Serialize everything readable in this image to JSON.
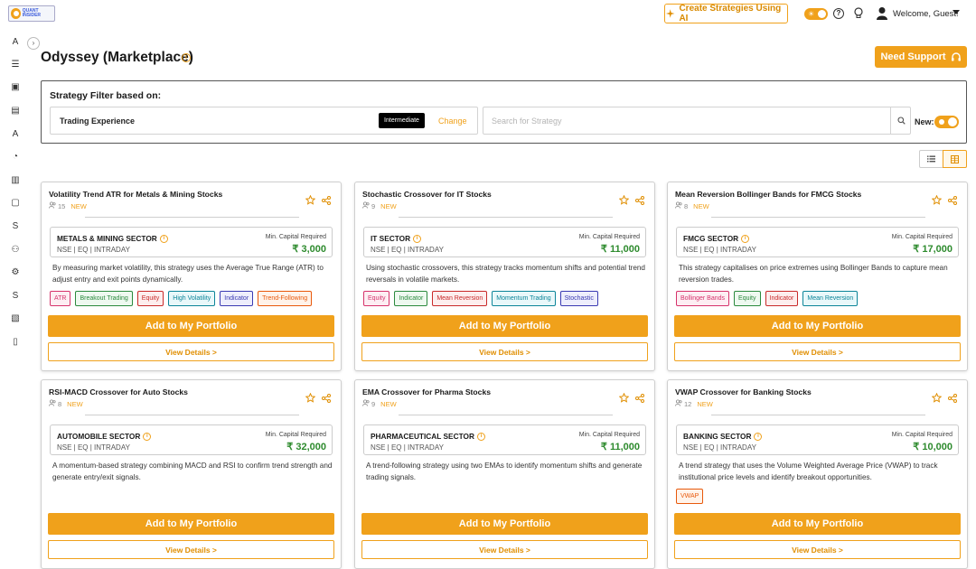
{
  "header": {
    "logo_text": "QUANT INSIDER",
    "create_ai_label": "Create Strategies Using AI",
    "welcome_text": "Welcome, Guest!",
    "help_glyph": "?",
    "bulb_glyph": "💡"
  },
  "sidebar": {
    "collapse_glyph": "›",
    "items": [
      {
        "glyph": "A",
        "icon": "text-a-icon"
      },
      {
        "glyph": "☰",
        "icon": "list-icon"
      },
      {
        "glyph": "▣",
        "icon": "terminal-icon"
      },
      {
        "glyph": "▤",
        "icon": "image-icon"
      },
      {
        "glyph": "A",
        "icon": "text-a-icon"
      },
      {
        "glyph": "◔",
        "icon": "gauge-icon"
      },
      {
        "glyph": "▥",
        "icon": "bar-chart-icon"
      },
      {
        "glyph": "▢",
        "icon": "book-icon"
      },
      {
        "glyph": "S",
        "icon": "text-s-icon"
      },
      {
        "glyph": "⚇",
        "icon": "users-icon"
      },
      {
        "glyph": "⚙",
        "icon": "gear-icon"
      },
      {
        "glyph": "S",
        "icon": "text-s-icon"
      },
      {
        "glyph": "▧",
        "icon": "wallet-icon"
      },
      {
        "glyph": "▯",
        "icon": "document-icon"
      }
    ]
  },
  "page": {
    "title": "Odyssey (Marketplace)",
    "info_glyph": "i",
    "need_support_label": "Need Support"
  },
  "filter": {
    "heading": "Strategy Filter based on:",
    "experience_label": "Trading Experience",
    "experience_value": "Intermediate",
    "change_label": "Change",
    "search_placeholder": "Search for Strategy",
    "new_label": "New:"
  },
  "colors": {
    "accent": "#f0a11b",
    "capital_green": "#2e8b2e"
  },
  "cards": [
    {
      "title": "Volatility Trend ATR for Metals & Mining Stocks",
      "users": "15",
      "new_label": "NEW",
      "sector": "METALS & MINING SECTOR",
      "sub": "NSE | EQ | INTRADAY",
      "cap_label": "Min. Capital Required",
      "capital": "₹ 3,000",
      "desc": "By measuring market volatility, this strategy uses the Average True Range (ATR) to adjust entry and exit points dynamically.",
      "tags": [
        {
          "label": "ATR",
          "color": "#d6336c",
          "bg": "#fdeef3"
        },
        {
          "label": "Breakout Trading",
          "color": "#2b8a3e",
          "bg": "#eef9f0"
        },
        {
          "label": "Equity",
          "color": "#c92a2a",
          "bg": "#fdeeee"
        },
        {
          "label": "High Volatility",
          "color": "#0c8599",
          "bg": "#e9f8fa"
        },
        {
          "label": "Indicator",
          "color": "#3b3bb3",
          "bg": "#eeeefc"
        },
        {
          "label": "Trend-Following",
          "color": "#e8590c",
          "bg": "#fff3ea"
        }
      ],
      "add_label": "Add to My Portfolio",
      "view_label": "View Details >"
    },
    {
      "title": "Stochastic Crossover for IT Stocks",
      "users": "9",
      "new_label": "NEW",
      "sector": "IT SECTOR",
      "sub": "NSE | EQ | INTRADAY",
      "cap_label": "Min. Capital Required",
      "capital": "₹ 11,000",
      "desc": "Using stochastic crossovers, this strategy tracks momentum shifts and potential trend reversals in volatile markets.",
      "tags": [
        {
          "label": "Equity",
          "color": "#d6336c",
          "bg": "#fdeef3"
        },
        {
          "label": "Indicator",
          "color": "#2b8a3e",
          "bg": "#eef9f0"
        },
        {
          "label": "Mean Reversion",
          "color": "#c92a2a",
          "bg": "#fdeeee"
        },
        {
          "label": "Momentum Trading",
          "color": "#0c8599",
          "bg": "#e9f8fa"
        },
        {
          "label": "Stochastic",
          "color": "#3b3bb3",
          "bg": "#eeeefc"
        }
      ],
      "add_label": "Add to My Portfolio",
      "view_label": "View Details >"
    },
    {
      "title": "Mean Reversion Bollinger Bands for FMCG Stocks",
      "users": "8",
      "new_label": "NEW",
      "sector": "FMCG SECTOR",
      "sub": "NSE | EQ | INTRADAY",
      "cap_label": "Min. Capital Required",
      "capital": "₹ 17,000",
      "desc": "This strategy capitalises on price extremes using Bollinger Bands to capture mean reversion trades.",
      "tags": [
        {
          "label": "Bollinger Bands",
          "color": "#d6336c",
          "bg": "#fdeef3"
        },
        {
          "label": "Equity",
          "color": "#2b8a3e",
          "bg": "#eef9f0"
        },
        {
          "label": "Indicator",
          "color": "#c92a2a",
          "bg": "#fdeeee"
        },
        {
          "label": "Mean Reversion",
          "color": "#0c8599",
          "bg": "#e9f8fa"
        }
      ],
      "add_label": "Add to My Portfolio",
      "view_label": "View Details >"
    },
    {
      "title": "RSI-MACD Crossover for Auto Stocks",
      "users": "8",
      "new_label": "NEW",
      "sector": "AUTOMOBILE SECTOR",
      "sub": "NSE | EQ | INTRADAY",
      "cap_label": "Min. Capital Required",
      "capital": "₹ 32,000",
      "desc": "A momentum-based strategy combining MACD and RSI to confirm trend strength and generate entry/exit signals.",
      "tags": [],
      "add_label": "Add to My Portfolio",
      "view_label": "View Details >"
    },
    {
      "title": "EMA Crossover for Pharma Stocks",
      "users": "9",
      "new_label": "NEW",
      "sector": "PHARMACEUTICAL SECTOR",
      "sub": "NSE | EQ | INTRADAY",
      "cap_label": "Min. Capital Required",
      "capital": "₹ 11,000",
      "desc": "A trend-following strategy using two EMAs to identify momentum shifts and generate trading signals.",
      "tags": [],
      "add_label": "Add to My Portfolio",
      "view_label": "View Details >"
    },
    {
      "title": "VWAP Crossover for Banking Stocks",
      "users": "12",
      "new_label": "NEW",
      "sector": "BANKING SECTOR",
      "sub": "NSE | EQ | INTRADAY",
      "cap_label": "Min. Capital Required",
      "capital": "₹ 10,000",
      "desc": "A trend strategy that uses the Volume Weighted Average Price (VWAP) to track institutional price levels and identify breakout opportunities.",
      "tags": [
        {
          "label": "VWAP",
          "color": "#e8590c",
          "bg": "#fff3ea"
        }
      ],
      "add_label": "Add to My Portfolio",
      "view_label": "View Details >"
    }
  ]
}
